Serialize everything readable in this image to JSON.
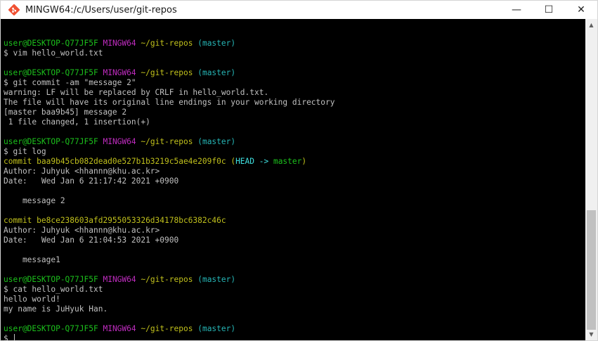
{
  "window": {
    "title": "MINGW64:/c/Users/user/git-repos",
    "minimize_glyph": "—",
    "maximize_glyph": "☐",
    "close_glyph": "✕",
    "icon": "git-bash-icon"
  },
  "colors": {
    "user": "#1cc11c",
    "msystem": "#c02cc0",
    "path": "#c0c01c",
    "branch": "#26b6b6",
    "text": "#c0c0c0"
  },
  "terminal": {
    "lines": [
      {
        "segments": [
          {
            "text": "",
            "c": "w"
          }
        ]
      },
      {
        "segments": [
          {
            "text": "user@DESKTOP-Q77JF5F",
            "c": "g"
          },
          {
            "text": " ",
            "c": "w"
          },
          {
            "text": "MINGW64",
            "c": "m"
          },
          {
            "text": " ",
            "c": "w"
          },
          {
            "text": "~/git-repos",
            "c": "y"
          },
          {
            "text": " ",
            "c": "w"
          },
          {
            "text": "(master)",
            "c": "c"
          }
        ]
      },
      {
        "segments": [
          {
            "text": "$ vim hello_world.txt",
            "c": "w"
          }
        ]
      },
      {
        "segments": [
          {
            "text": "",
            "c": "w"
          }
        ]
      },
      {
        "segments": [
          {
            "text": "user@DESKTOP-Q77JF5F",
            "c": "g"
          },
          {
            "text": " ",
            "c": "w"
          },
          {
            "text": "MINGW64",
            "c": "m"
          },
          {
            "text": " ",
            "c": "w"
          },
          {
            "text": "~/git-repos",
            "c": "y"
          },
          {
            "text": " ",
            "c": "w"
          },
          {
            "text": "(master)",
            "c": "c"
          }
        ]
      },
      {
        "segments": [
          {
            "text": "$ git commit -am \"message 2\"",
            "c": "w"
          }
        ]
      },
      {
        "segments": [
          {
            "text": "warning: LF will be replaced by CRLF in hello_world.txt.",
            "c": "w"
          }
        ]
      },
      {
        "segments": [
          {
            "text": "The file will have its original line endings in your working directory",
            "c": "w"
          }
        ]
      },
      {
        "segments": [
          {
            "text": "[master baa9b45] message 2",
            "c": "w"
          }
        ]
      },
      {
        "segments": [
          {
            "text": " 1 file changed, 1 insertion(+)",
            "c": "w"
          }
        ]
      },
      {
        "segments": [
          {
            "text": "",
            "c": "w"
          }
        ]
      },
      {
        "segments": [
          {
            "text": "user@DESKTOP-Q77JF5F",
            "c": "g"
          },
          {
            "text": " ",
            "c": "w"
          },
          {
            "text": "MINGW64",
            "c": "m"
          },
          {
            "text": " ",
            "c": "w"
          },
          {
            "text": "~/git-repos",
            "c": "y"
          },
          {
            "text": " ",
            "c": "w"
          },
          {
            "text": "(master)",
            "c": "c"
          }
        ]
      },
      {
        "segments": [
          {
            "text": "$ git log",
            "c": "w"
          }
        ]
      },
      {
        "segments": [
          {
            "text": "commit baa9b45cb082dead0e527b1b3219c5ae4e209f0c",
            "c": "y"
          },
          {
            "text": " (",
            "c": "y"
          },
          {
            "text": "HEAD -> ",
            "c": "hc"
          },
          {
            "text": "master",
            "c": "hg"
          },
          {
            "text": ")",
            "c": "y"
          }
        ]
      },
      {
        "segments": [
          {
            "text": "Author: Juhyuk <hhannn@khu.ac.kr>",
            "c": "w"
          }
        ]
      },
      {
        "segments": [
          {
            "text": "Date:   Wed Jan 6 21:17:42 2021 +0900",
            "c": "w"
          }
        ]
      },
      {
        "segments": [
          {
            "text": "",
            "c": "w"
          }
        ]
      },
      {
        "segments": [
          {
            "text": "    message 2",
            "c": "w"
          }
        ]
      },
      {
        "segments": [
          {
            "text": "",
            "c": "w"
          }
        ]
      },
      {
        "segments": [
          {
            "text": "commit be8ce238603afd2955053326d34178bc6382c46c",
            "c": "y"
          }
        ]
      },
      {
        "segments": [
          {
            "text": "Author: Juhyuk <hhannn@khu.ac.kr>",
            "c": "w"
          }
        ]
      },
      {
        "segments": [
          {
            "text": "Date:   Wed Jan 6 21:04:53 2021 +0900",
            "c": "w"
          }
        ]
      },
      {
        "segments": [
          {
            "text": "",
            "c": "w"
          }
        ]
      },
      {
        "segments": [
          {
            "text": "    message1",
            "c": "w"
          }
        ]
      },
      {
        "segments": [
          {
            "text": "",
            "c": "w"
          }
        ]
      },
      {
        "segments": [
          {
            "text": "user@DESKTOP-Q77JF5F",
            "c": "g"
          },
          {
            "text": " ",
            "c": "w"
          },
          {
            "text": "MINGW64",
            "c": "m"
          },
          {
            "text": " ",
            "c": "w"
          },
          {
            "text": "~/git-repos",
            "c": "y"
          },
          {
            "text": " ",
            "c": "w"
          },
          {
            "text": "(master)",
            "c": "c"
          }
        ]
      },
      {
        "segments": [
          {
            "text": "$ cat hello_world.txt",
            "c": "w"
          }
        ]
      },
      {
        "segments": [
          {
            "text": "hello world!",
            "c": "w"
          }
        ]
      },
      {
        "segments": [
          {
            "text": "my name is JuHyuk Han.",
            "c": "w"
          }
        ]
      },
      {
        "segments": [
          {
            "text": "",
            "c": "w"
          }
        ]
      },
      {
        "segments": [
          {
            "text": "user@DESKTOP-Q77JF5F",
            "c": "g"
          },
          {
            "text": " ",
            "c": "w"
          },
          {
            "text": "MINGW64",
            "c": "m"
          },
          {
            "text": " ",
            "c": "w"
          },
          {
            "text": "~/git-repos",
            "c": "y"
          },
          {
            "text": " ",
            "c": "w"
          },
          {
            "text": "(master)",
            "c": "c"
          }
        ]
      },
      {
        "segments": [
          {
            "text": "$ ",
            "c": "w"
          }
        ],
        "cursor": true
      }
    ]
  },
  "scrollbar": {
    "up_glyph": "▲",
    "down_glyph": "▼"
  }
}
